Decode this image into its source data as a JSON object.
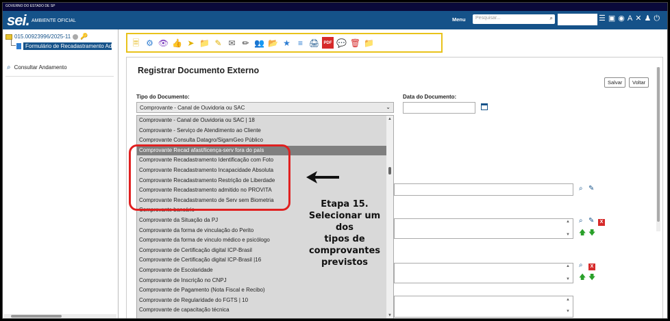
{
  "header": {
    "gov_label": "GOVERNO DO ESTADO DE SP",
    "logo": "sei.",
    "env_label": "AMBIENTE OFICIAL",
    "menu_label": "Menu",
    "search_placeholder": "Pesquisar...",
    "brand_color": "#155289",
    "icons": [
      "list-icon",
      "screen-icon",
      "info-icon",
      "font-size-icon",
      "tools-icon",
      "user-icon",
      "power-icon"
    ]
  },
  "sidebar": {
    "process_number": "015.00923996/2025-11",
    "document_label": "Formulário de Recadastramento Adm",
    "consult_label": "Consultar Andamento"
  },
  "toolbar": {
    "icons": [
      "new-document-icon",
      "settings-doc-icon",
      "eye-icon",
      "thumb-icon",
      "forward-icon",
      "folder-info-icon",
      "sign-icon",
      "mail-icon",
      "pencil-icon",
      "users-icon",
      "folder-plus-icon",
      "star-doc-icon",
      "layers-icon",
      "print-icon",
      "pdf-icon",
      "comment-icon",
      "trash-icon",
      "folder-delete-icon"
    ],
    "pdf_text": "PDF"
  },
  "form": {
    "title": "Registrar Documento Externo",
    "save_label": "Salvar",
    "back_label": "Voltar",
    "tipo_label": "Tipo do Documento:",
    "tipo_selected": "Comprovante - Canal de Ouvidoria ou SAC",
    "data_label": "Data do Documento:",
    "remove_label": "X",
    "options": [
      "Comprovante - Canal de Ouvidoria ou SAC | 18",
      "Comprovante - Serviço de Atendimento ao Cliente",
      "Comprovante Consulta Datagro/SigamGeo Público",
      "Comprovante Recad afast/licença-serv fora do país",
      "Comprovante Recadastramento Identificação com Foto",
      "Comprovante Recadastramento Incapacidade Absoluta",
      "Comprovante Recadastramento Restrição de Liberdade",
      "Comprovante Recadastramento admitido no PROVITA",
      "Comprovante Recadastramento de Serv sem Biometria",
      "Comprovante bancário",
      "Comprovante da Situação da PJ",
      "Comprovante da forma de vinculação do Perito",
      "Comprovante da forma de vinculo médico e psicólogo",
      "Comprovante de Certificação digital ICP-Brasil",
      "Comprovante de Certificação digital ICP-Brasil |16",
      "Comprovante de Escolaridade",
      "Comprovante de Inscrição no CNPJ",
      "Comprovante de Pagamento (Nota Fiscal e Recibo)",
      "Comprovante de Regularidade do FGTS | 10",
      "Comprovante de capacitação técnica"
    ],
    "selected_index": 3
  },
  "annotation": {
    "step": "Etapa 15.",
    "line1": "Selecionar um dos",
    "line2": "tipos de",
    "line3": "comprovantes",
    "line4": "previstos",
    "highlight_color": "#e02020"
  }
}
